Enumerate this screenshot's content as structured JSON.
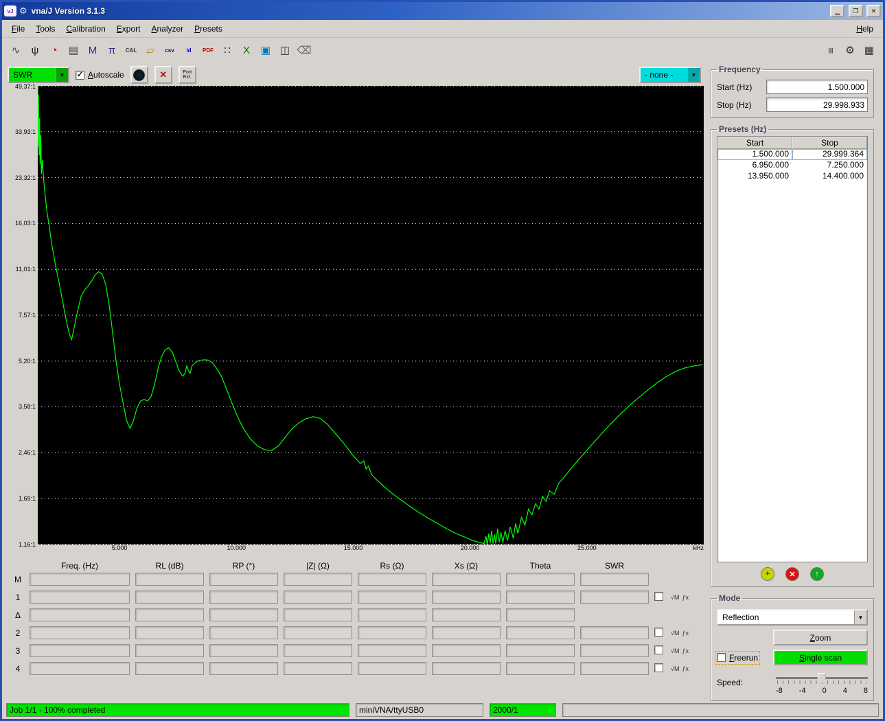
{
  "window": {
    "title": "vna/J Version 3.1.3"
  },
  "menu": {
    "left": [
      {
        "label": "File",
        "m": 0
      },
      {
        "label": "Tools",
        "m": 0
      },
      {
        "label": "Calibration",
        "m": 0
      },
      {
        "label": "Export",
        "m": 0
      },
      {
        "label": "Analyzer",
        "m": 0
      },
      {
        "label": "Presets",
        "m": 0
      }
    ],
    "right": [
      {
        "label": "Help",
        "m": 0
      }
    ]
  },
  "toolbar": {
    "left": [
      {
        "name": "frequency-sweep-icon",
        "glyph": "∿",
        "color": "#444444",
        "small": false
      },
      {
        "name": "antenna-icon",
        "glyph": "ψ",
        "color": "#222222",
        "small": false
      },
      {
        "name": "clock-icon",
        "glyph": "◔",
        "color": "#bb0000",
        "small": false
      },
      {
        "name": "printer-icon",
        "glyph": "▤",
        "color": "#444444",
        "small": false
      },
      {
        "name": "multi-marker-icon",
        "glyph": "M",
        "color": "#223388",
        "small": false
      },
      {
        "name": "pi-network-icon",
        "glyph": "π",
        "color": "#223388",
        "small": false
      },
      {
        "name": "calibration-icon",
        "glyph": "CAL",
        "color": "#333333",
        "small": true
      },
      {
        "name": "folder-open-icon",
        "glyph": "▱",
        "color": "#bb8800",
        "small": false
      },
      {
        "name": "csv-export-icon",
        "glyph": "csv",
        "color": "#0000bb",
        "small": true
      },
      {
        "name": "id-export-icon",
        "glyph": "id",
        "color": "#0000bb",
        "small": true
      },
      {
        "name": "pdf-export-icon",
        "glyph": "PDF",
        "color": "#bb0000",
        "small": true
      },
      {
        "name": "sample-points-icon",
        "glyph": "∷",
        "color": "#333333",
        "small": false
      },
      {
        "name": "xls-export-icon",
        "glyph": "X",
        "color": "#007700",
        "small": false
      },
      {
        "name": "image-export-icon",
        "glyph": "▣",
        "color": "#0077bb",
        "small": false
      },
      {
        "name": "zoom-graph-icon",
        "glyph": "◫",
        "color": "#333333",
        "small": false
      },
      {
        "name": "eraser-icon",
        "glyph": "⌫",
        "color": "#666666",
        "small": false
      }
    ],
    "right": [
      {
        "name": "driver-adjust-icon",
        "glyph": "|||",
        "color": "#333333",
        "small": true
      },
      {
        "name": "tools-icon",
        "glyph": "⚙",
        "color": "#333333",
        "small": false
      },
      {
        "name": "table-view-icon",
        "glyph": "▦",
        "color": "#333333",
        "small": false
      }
    ]
  },
  "chart_header": {
    "left_scale": "SWR",
    "autoscale_label": "Autoscale",
    "autoscale_m": 0,
    "autoscale_checked": true,
    "port_ext_label": "Port Ext.",
    "right_scale": "- none -"
  },
  "chart_data": {
    "type": "line",
    "title": "SWR sweep trace",
    "x_unit": "kHz",
    "x_range_mhz": [
      1.5,
      30.0
    ],
    "x_ticks": [
      "5.000",
      "10.000",
      "15.000",
      "20.000",
      "25.000"
    ],
    "x_tick_values_mhz": [
      5,
      10,
      15,
      20,
      25
    ],
    "y_scale": "log",
    "grid": "horizontal-dotted",
    "y_ticks": [
      "49,37:1",
      "33,93:1",
      "23,32:1",
      "16,03:1",
      "11,01:1",
      "7,57:1",
      "5,20:1",
      "3,58:1",
      "2,46:1",
      "1,69:1",
      "1,16:1"
    ],
    "y_tick_values": [
      49.37,
      33.93,
      23.32,
      16.03,
      11.01,
      7.57,
      5.2,
      3.58,
      2.46,
      1.69,
      1.16
    ],
    "series": [
      {
        "name": "SWR",
        "color": "#00ff00",
        "points": [
          [
            1.5,
            49.0
          ],
          [
            1.51,
            30.0
          ],
          [
            1.53,
            46.0
          ],
          [
            1.56,
            28.0
          ],
          [
            1.58,
            38.0
          ],
          [
            1.6,
            26.0
          ],
          [
            1.63,
            33.0
          ],
          [
            1.66,
            24.0
          ],
          [
            1.7,
            27.0
          ],
          [
            1.75,
            23.0
          ],
          [
            1.82,
            20.0
          ],
          [
            1.9,
            17.5
          ],
          [
            2.0,
            15.5
          ],
          [
            2.1,
            13.5
          ],
          [
            2.25,
            11.5
          ],
          [
            2.4,
            10.0
          ],
          [
            2.55,
            8.6
          ],
          [
            2.7,
            7.4
          ],
          [
            2.85,
            6.5
          ],
          [
            2.95,
            6.2
          ],
          [
            3.05,
            6.8
          ],
          [
            3.2,
            7.8
          ],
          [
            3.35,
            8.8
          ],
          [
            3.5,
            9.3
          ],
          [
            3.65,
            9.6
          ],
          [
            3.8,
            10.0
          ],
          [
            3.95,
            10.5
          ],
          [
            4.1,
            10.8
          ],
          [
            4.25,
            10.6
          ],
          [
            4.4,
            9.8
          ],
          [
            4.55,
            8.3
          ],
          [
            4.7,
            6.6
          ],
          [
            4.85,
            5.2
          ],
          [
            5.0,
            4.3
          ],
          [
            5.15,
            3.7
          ],
          [
            5.3,
            3.2
          ],
          [
            5.45,
            3.0
          ],
          [
            5.6,
            3.2
          ],
          [
            5.75,
            3.55
          ],
          [
            5.9,
            3.75
          ],
          [
            6.05,
            3.8
          ],
          [
            6.2,
            3.75
          ],
          [
            6.35,
            3.9
          ],
          [
            6.5,
            4.3
          ],
          [
            6.65,
            4.9
          ],
          [
            6.8,
            5.4
          ],
          [
            6.95,
            5.7
          ],
          [
            7.1,
            5.8
          ],
          [
            7.25,
            5.6
          ],
          [
            7.4,
            5.2
          ],
          [
            7.55,
            4.8
          ],
          [
            7.7,
            4.6
          ],
          [
            7.8,
            4.7
          ],
          [
            7.88,
            5.0
          ],
          [
            7.95,
            4.8
          ],
          [
            8.02,
            4.7
          ],
          [
            8.1,
            5.0
          ],
          [
            8.2,
            5.1
          ],
          [
            8.35,
            5.2
          ],
          [
            8.55,
            5.25
          ],
          [
            8.75,
            5.25
          ],
          [
            8.95,
            5.15
          ],
          [
            9.15,
            4.9
          ],
          [
            9.35,
            4.6
          ],
          [
            9.55,
            4.2
          ],
          [
            9.8,
            3.7
          ],
          [
            10.05,
            3.3
          ],
          [
            10.3,
            3.0
          ],
          [
            10.6,
            2.75
          ],
          [
            10.9,
            2.6
          ],
          [
            11.2,
            2.52
          ],
          [
            11.5,
            2.5
          ],
          [
            11.8,
            2.6
          ],
          [
            12.1,
            2.8
          ],
          [
            12.4,
            3.0
          ],
          [
            12.7,
            3.15
          ],
          [
            13.0,
            3.25
          ],
          [
            13.3,
            3.3
          ],
          [
            13.6,
            3.25
          ],
          [
            13.9,
            3.1
          ],
          [
            14.2,
            2.9
          ],
          [
            14.6,
            2.65
          ],
          [
            15.0,
            2.4
          ],
          [
            15.3,
            2.25
          ],
          [
            15.45,
            2.3
          ],
          [
            15.55,
            2.15
          ],
          [
            15.65,
            2.2
          ],
          [
            15.8,
            2.05
          ],
          [
            16.0,
            1.97
          ],
          [
            16.3,
            1.87
          ],
          [
            16.6,
            1.78
          ],
          [
            17.0,
            1.68
          ],
          [
            17.4,
            1.59
          ],
          [
            17.8,
            1.51
          ],
          [
            18.2,
            1.44
          ],
          [
            18.6,
            1.38
          ],
          [
            19.0,
            1.32
          ],
          [
            19.4,
            1.27
          ],
          [
            19.8,
            1.23
          ],
          [
            20.1,
            1.2
          ],
          [
            20.4,
            1.18
          ],
          [
            20.6,
            1.17
          ],
          [
            20.68,
            1.24
          ],
          [
            20.74,
            1.16
          ],
          [
            20.8,
            1.27
          ],
          [
            20.86,
            1.17
          ],
          [
            20.92,
            1.3
          ],
          [
            20.98,
            1.17
          ],
          [
            21.04,
            1.26
          ],
          [
            21.1,
            1.17
          ],
          [
            21.18,
            1.32
          ],
          [
            21.25,
            1.18
          ],
          [
            21.32,
            1.28
          ],
          [
            21.4,
            1.18
          ],
          [
            21.5,
            1.3
          ],
          [
            21.6,
            1.2
          ],
          [
            21.72,
            1.34
          ],
          [
            21.85,
            1.22
          ],
          [
            21.95,
            1.38
          ],
          [
            22.05,
            1.27
          ],
          [
            22.2,
            1.45
          ],
          [
            22.35,
            1.36
          ],
          [
            22.5,
            1.55
          ],
          [
            22.65,
            1.48
          ],
          [
            22.8,
            1.62
          ],
          [
            22.95,
            1.55
          ],
          [
            23.1,
            1.72
          ],
          [
            23.25,
            1.65
          ],
          [
            23.4,
            1.8
          ],
          [
            23.6,
            1.75
          ],
          [
            23.8,
            1.92
          ],
          [
            24.0,
            2.0
          ],
          [
            24.3,
            2.15
          ],
          [
            24.6,
            2.3
          ],
          [
            24.9,
            2.45
          ],
          [
            25.2,
            2.62
          ],
          [
            25.6,
            2.85
          ],
          [
            26.0,
            3.1
          ],
          [
            26.4,
            3.35
          ],
          [
            26.8,
            3.6
          ],
          [
            27.2,
            3.85
          ],
          [
            27.6,
            4.1
          ],
          [
            28.0,
            4.35
          ],
          [
            28.4,
            4.58
          ],
          [
            28.8,
            4.78
          ],
          [
            29.2,
            4.92
          ],
          [
            29.6,
            5.0
          ],
          [
            29.95,
            5.05
          ]
        ]
      }
    ]
  },
  "frequency": {
    "title": "Frequency",
    "start_label": "Start (Hz)",
    "start_value": "1.500.000",
    "stop_label": "Stop (Hz)",
    "stop_value": "29.998.933"
  },
  "presets": {
    "title": "Presets (Hz)",
    "columns": [
      "Start",
      "Stop"
    ],
    "rows": [
      [
        "1.500.000",
        "29.999.364"
      ],
      [
        "6.950.000",
        "7.250.000"
      ],
      [
        "13.950.000",
        "14.400.000"
      ]
    ],
    "selected_row": 0
  },
  "mode": {
    "title": "Mode",
    "mode_value": "Reflection",
    "zoom_label": "Zoom",
    "zoom_m": 0,
    "freerun_label": "Freerun",
    "freerun_m": 0,
    "freerun_checked": false,
    "single_scan_label": "Single scan",
    "single_scan_m": 0,
    "speed_label": "Speed:",
    "speed_labels": [
      "-8",
      "-4",
      "0",
      "4",
      "8"
    ],
    "speed_value": 0
  },
  "marker_table": {
    "headers": [
      "Freq. (Hz)",
      "RL (dB)",
      "RP (°)",
      "|Z| (Ω)",
      "Rs (Ω)",
      "Xs (Ω)",
      "Theta",
      "SWR"
    ],
    "rows": [
      {
        "label": "M",
        "fields": 8,
        "extras": false
      },
      {
        "label": "1",
        "fields": 8,
        "extras": true
      },
      {
        "label": "Δ",
        "fields": 7,
        "extras": false
      },
      {
        "label": "2",
        "fields": 8,
        "extras": true
      },
      {
        "label": "3",
        "fields": 8,
        "extras": true
      },
      {
        "label": "4",
        "fields": 8,
        "extras": true
      }
    ],
    "extra_icons": [
      {
        "name": "sqrt-marker-icon",
        "glyph": "√M"
      },
      {
        "name": "formula-marker-icon",
        "glyph": "ƒx"
      }
    ]
  },
  "statusbar": {
    "progress": "Job 1/1 - 100% completed",
    "device": "miniVNA/ttyUSB0",
    "samples": "2000/1"
  }
}
